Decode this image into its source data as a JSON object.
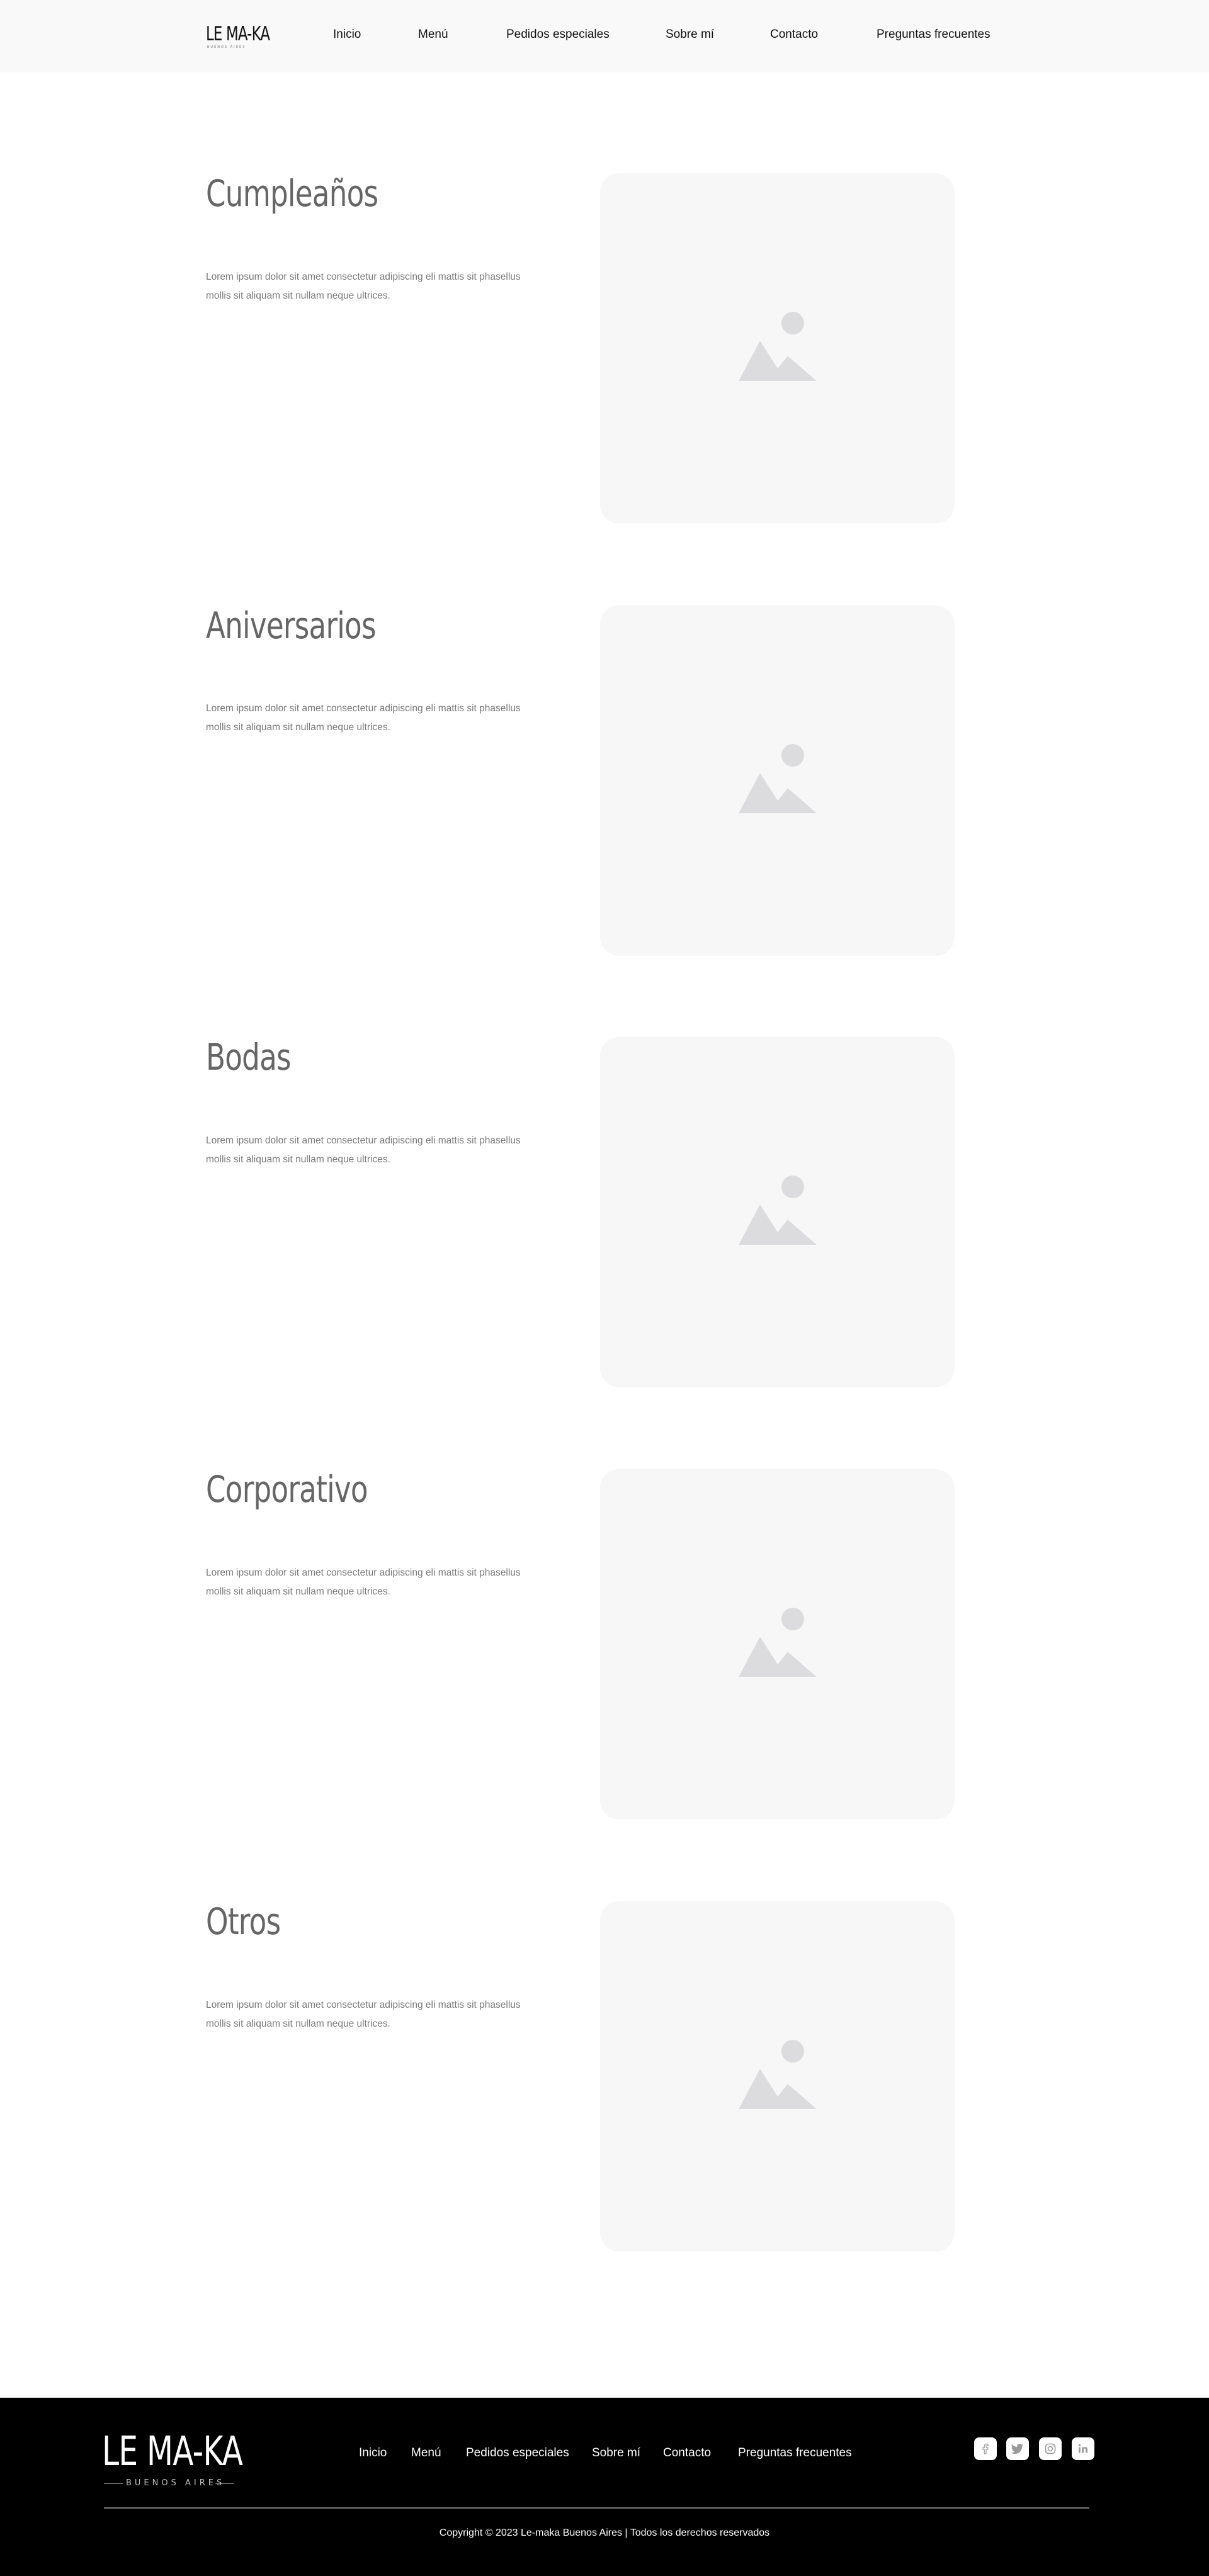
{
  "header": {
    "logo_text": "LE MA-KA",
    "logo_tagline": "BUENOS AIRES",
    "nav": [
      "Inicio",
      "Menú",
      "Pedidos especiales",
      "Sobre mí",
      "Contacto",
      "Preguntas frecuentes"
    ]
  },
  "sections": [
    {
      "title": "Cumpleaños",
      "text": "Lorem ipsum dolor sit amet consectetur adipiscing eli mattis sit phasellus mollis sit aliquam sit nullam neque ultrices.",
      "image_icon": "image-placeholder-icon"
    },
    {
      "title": "Aniversarios",
      "text": "Lorem ipsum dolor sit amet consectetur adipiscing eli mattis sit phasellus mollis sit aliquam sit nullam neque ultrices.",
      "image_icon": "image-placeholder-icon"
    },
    {
      "title": "Bodas",
      "text": "Lorem ipsum dolor sit amet consectetur adipiscing eli mattis sit phasellus mollis sit aliquam sit nullam neque ultrices.",
      "image_icon": "image-placeholder-icon"
    },
    {
      "title": "Corporativo",
      "text": "Lorem ipsum dolor sit amet consectetur adipiscing eli mattis sit phasellus mollis sit aliquam sit nullam neque ultrices.",
      "image_icon": "image-placeholder-icon"
    },
    {
      "title": "Otros",
      "text": "Lorem ipsum dolor sit amet consectetur adipiscing eli mattis sit phasellus mollis sit aliquam sit nullam neque ultrices.",
      "image_icon": "image-placeholder-icon"
    }
  ],
  "footer": {
    "logo_text": "LE MA-KA",
    "logo_tagline": "BUENOS AIRES",
    "nav": [
      "Inicio",
      "Menú",
      "Pedidos especiales",
      "Sobre mí",
      "Contacto",
      "Preguntas frecuentes"
    ],
    "social_icons": [
      "facebook-icon",
      "twitter-icon",
      "instagram-icon",
      "linkedin-icon"
    ],
    "copyright": "Copyright © 2023 Le-maka Buenos Aires | Todos los derechos reservados"
  },
  "colors": {
    "header_bg": "#f9f9f9",
    "title": "#666666",
    "body_text": "#7a7a7a",
    "card_bg": "#f7f7f7",
    "placeholder_icon": "#dcdcde",
    "footer_bg": "#000000"
  }
}
